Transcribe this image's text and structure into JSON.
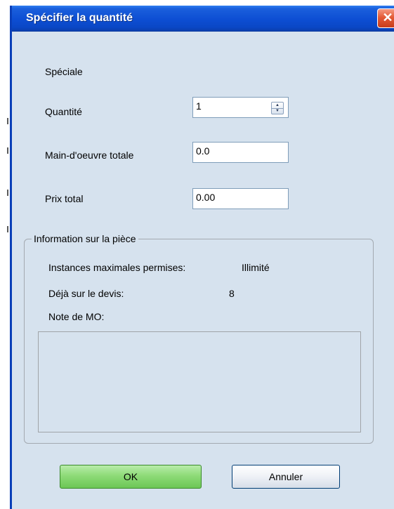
{
  "window": {
    "title": "Spécifier la quantité",
    "close_glyph": "✕"
  },
  "form": {
    "special_label": "Spéciale",
    "quantity_label": "Quantité",
    "quantity_value": "1",
    "labor_label": "Main-d'oeuvre totale",
    "labor_value": "0.0",
    "price_label": "Prix total",
    "price_value": "0.00"
  },
  "part_info": {
    "group_title": "Information sur la pièce",
    "max_instances_label": "Instances maximales permises:",
    "max_instances_value": "Illimité",
    "already_on_quote_label": "Déjà sur le devis:",
    "already_on_quote_value": "8",
    "labor_note_label": "Note de MO:",
    "labor_note_text": ""
  },
  "buttons": {
    "ok_label": "OK",
    "cancel_label": "Annuler"
  },
  "icons": {
    "close": "close-icon",
    "spin_up": "arrow-up-icon",
    "spin_down": "arrow-down-icon"
  },
  "colors": {
    "titlebar": "#0d4ed3",
    "dialog_bg": "#d6e2ee",
    "close_button": "#e35a36",
    "ok_button": "#8edb78"
  }
}
